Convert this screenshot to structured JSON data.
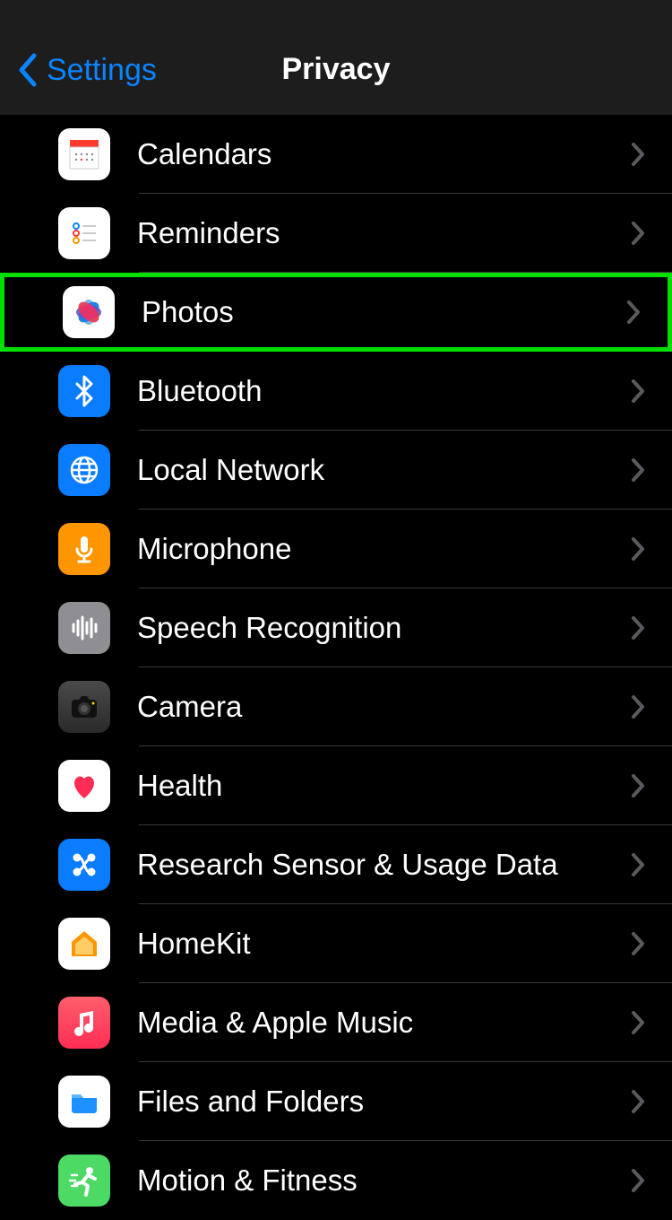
{
  "nav": {
    "back": "Settings",
    "title": "Privacy"
  },
  "rows": [
    {
      "id": "calendars",
      "label": "Calendars"
    },
    {
      "id": "reminders",
      "label": "Reminders"
    },
    {
      "id": "photos",
      "label": "Photos",
      "highlighted": true
    },
    {
      "id": "bluetooth",
      "label": "Bluetooth"
    },
    {
      "id": "localnet",
      "label": "Local Network"
    },
    {
      "id": "mic",
      "label": "Microphone"
    },
    {
      "id": "speech",
      "label": "Speech Recognition"
    },
    {
      "id": "camera",
      "label": "Camera"
    },
    {
      "id": "health",
      "label": "Health"
    },
    {
      "id": "research",
      "label": "Research Sensor & Usage Data"
    },
    {
      "id": "homekit",
      "label": "HomeKit"
    },
    {
      "id": "media",
      "label": "Media & Apple Music"
    },
    {
      "id": "files",
      "label": "Files and Folders"
    },
    {
      "id": "motion",
      "label": "Motion & Fitness"
    }
  ]
}
